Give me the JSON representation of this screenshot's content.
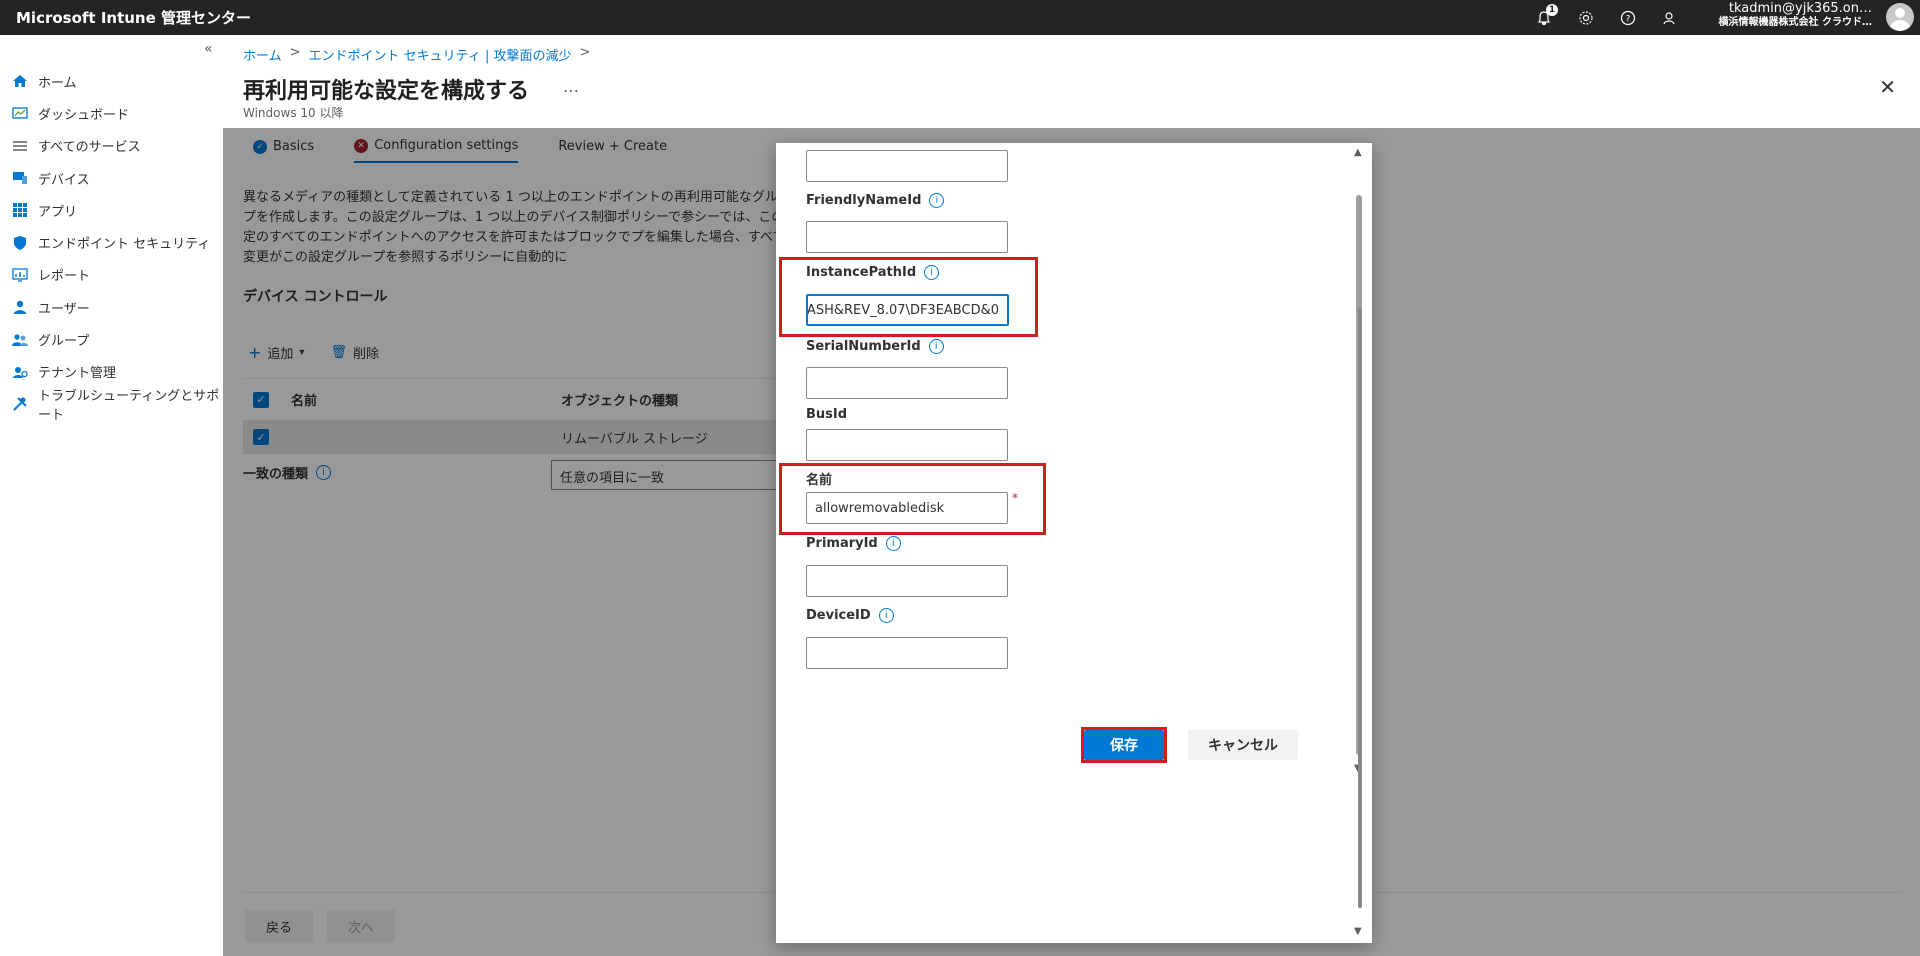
{
  "app": {
    "title": "Microsoft Intune 管理センター",
    "account_email": "tkadmin@yjk365.on…",
    "account_org": "横浜情報機器株式会社 クラウド…",
    "notification_count": "1"
  },
  "sidebar": {
    "collapse": "«",
    "items": [
      {
        "label": "ホーム",
        "icon": "home-icon",
        "color": "#0078d4"
      },
      {
        "label": "ダッシュボード",
        "icon": "dashboard-icon",
        "color": "#0078d4"
      },
      {
        "label": "すべてのサービス",
        "icon": "list-icon",
        "color": "#605e5c"
      },
      {
        "label": "デバイス",
        "icon": "device-icon",
        "color": "#0078d4"
      },
      {
        "label": "アプリ",
        "icon": "apps-icon",
        "color": "#0078d4"
      },
      {
        "label": "エンドポイント セキュリティ",
        "icon": "shield-icon",
        "color": "#0078d4"
      },
      {
        "label": "レポート",
        "icon": "report-icon",
        "color": "#0078d4"
      },
      {
        "label": "ユーザー",
        "icon": "user-icon",
        "color": "#0078d4"
      },
      {
        "label": "グループ",
        "icon": "group-icon",
        "color": "#0078d4"
      },
      {
        "label": "テナント管理",
        "icon": "tenant-icon",
        "color": "#0078d4"
      },
      {
        "label": "トラブルシューティングとサポート",
        "icon": "tools-icon",
        "color": "#0078d4"
      }
    ]
  },
  "header": {
    "breadcrumb": [
      "ホーム",
      "エンドポイント セキュリティ | 攻撃面の減少"
    ],
    "breadcrumb_sep": ">",
    "title": "再利用可能な設定を構成する",
    "more": "…",
    "subtitle": "Windows 10 以降",
    "close": "✕"
  },
  "tabs": [
    {
      "label": "Basics",
      "status": "complete"
    },
    {
      "label": "Configuration settings",
      "status": "error"
    },
    {
      "label": "Review + Create",
      "status": "none"
    }
  ],
  "content": {
    "description": "異なるメディアの種類として定義されている 1 つ以上のエンドポイントの再利用可能なグループを作成します。この設定グループは、1 つ以上のデバイス制御ポリシーで参シーでは、この設定のすべてのエンドポイントへのアクセスを許可またはブロックでプを編集した場合、すべての変更がこの設定グループを参照するポリシーに自動的に",
    "section_title": "デバイス コントロール",
    "toolbar": {
      "add": "追加",
      "delete": "削除"
    },
    "table": {
      "columns": [
        "名前",
        "オブジェクトの種類"
      ],
      "rows": [
        {
          "name": "",
          "type": "リムーバブル ストレージ"
        }
      ]
    },
    "match_label": "一致の種類",
    "match_value": "任意の項目に一致",
    "back": "戻る",
    "next": "次へ"
  },
  "modal": {
    "fields": [
      {
        "label": "",
        "value": "",
        "info": false
      },
      {
        "label": "FriendlyNameId",
        "value": "",
        "info": true
      },
      {
        "label": "InstancePathId",
        "value": "ASH&REV_8.07\\DF3EABCD&0",
        "info": true
      },
      {
        "label": "SerialNumberId",
        "value": "",
        "info": true
      },
      {
        "label": "BusId",
        "value": "",
        "info": false
      },
      {
        "label": "名前",
        "value": "allowremovabledisk",
        "info": false,
        "required": true
      },
      {
        "label": "PrimaryId",
        "value": "",
        "info": true
      },
      {
        "label": "DeviceID",
        "value": "",
        "info": true
      }
    ],
    "required_mark": "*",
    "save": "保存",
    "cancel": "キャンセル"
  },
  "colors": {
    "accent": "#0078d4",
    "highlight": "#d71920",
    "error": "#a4262c"
  }
}
